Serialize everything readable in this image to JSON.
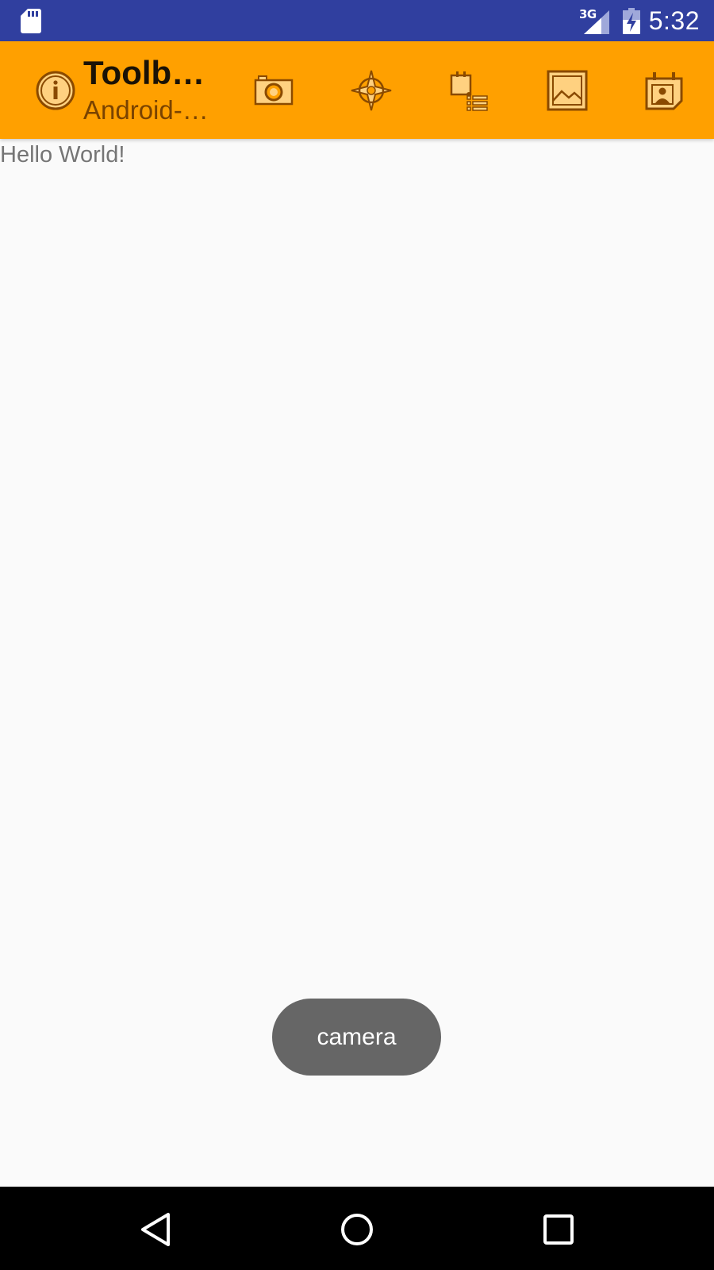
{
  "status_bar": {
    "network_type": "3G",
    "time": "5:32"
  },
  "toolbar": {
    "title": "Toolb…",
    "subtitle": "Android-…",
    "icons": [
      "info-icon",
      "camera-icon",
      "navigation-icon",
      "task-list-icon",
      "image-icon",
      "calendar-contact-icon"
    ],
    "background_color": "#FFA000",
    "icon_color": "#8a4a00"
  },
  "content": {
    "text": "Hello World!"
  },
  "toast": {
    "message": "camera"
  },
  "navigation_bar": {
    "icons": [
      "back-icon",
      "home-icon",
      "recents-icon"
    ]
  }
}
